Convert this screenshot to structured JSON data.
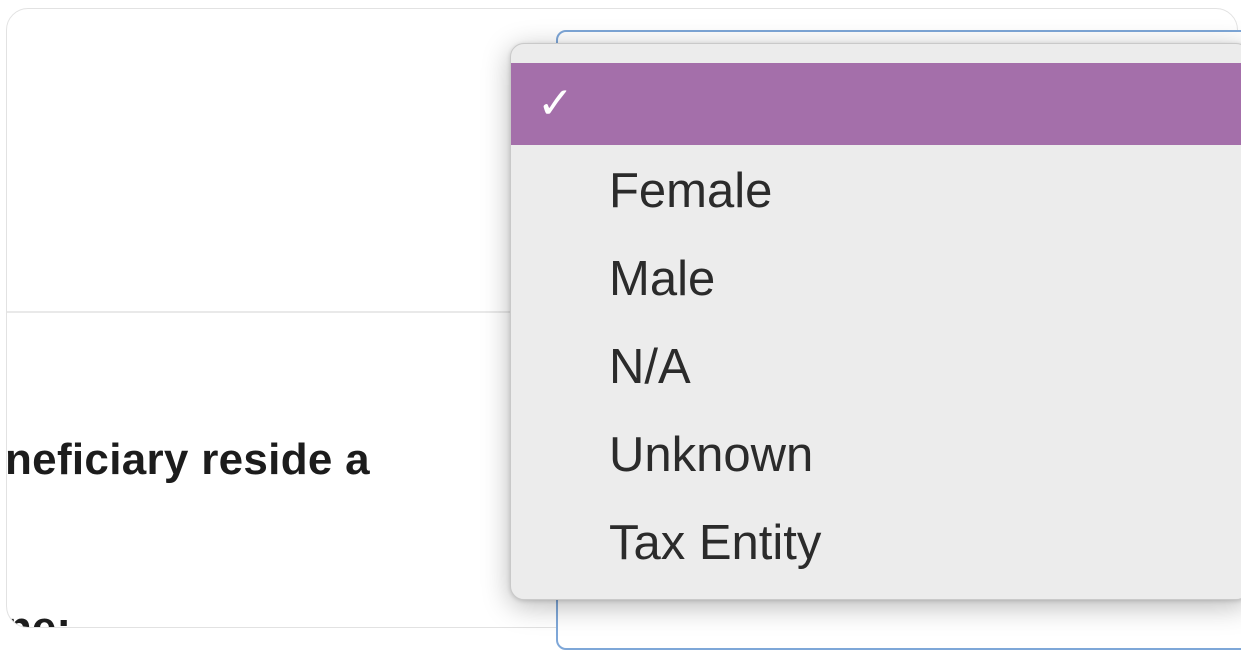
{
  "form": {
    "question_text": "neficiary reside a",
    "next_label_text": "ne:"
  },
  "dropdown": {
    "check_glyph": "✓",
    "options": [
      {
        "label": "",
        "selected": true
      },
      {
        "label": "Female",
        "selected": false
      },
      {
        "label": "Male",
        "selected": false
      },
      {
        "label": "N/A",
        "selected": false
      },
      {
        "label": "Unknown",
        "selected": false
      },
      {
        "label": "Tax Entity",
        "selected": false
      }
    ],
    "highlight_color": "#a46faa",
    "menu_background": "#ececec"
  }
}
